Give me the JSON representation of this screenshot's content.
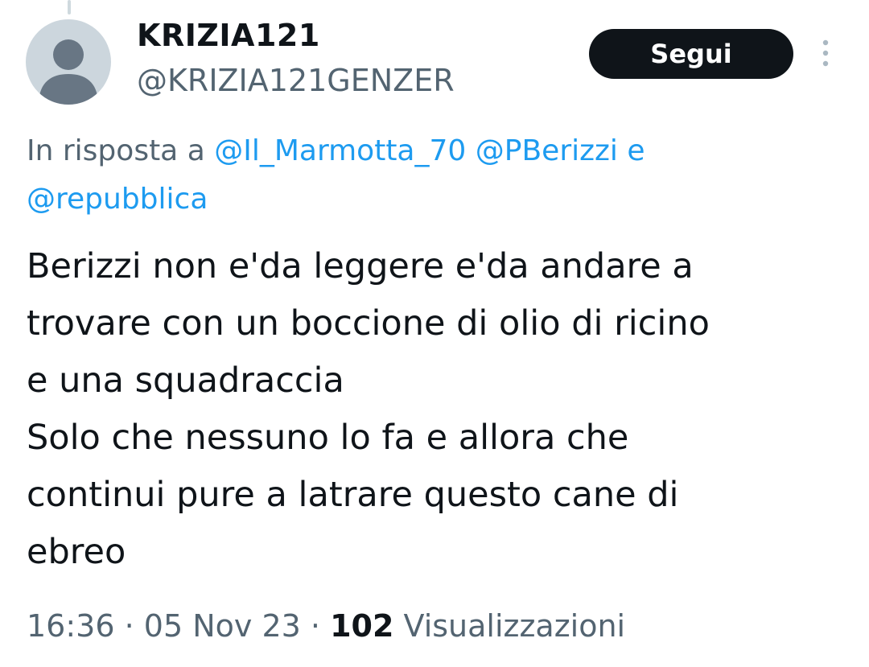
{
  "tweet": {
    "author": {
      "display_name": "KRIZIA121",
      "handle": "@KRIZIA121GENZER",
      "avatar_icon": "default-profile-icon"
    },
    "follow_label": "Segui",
    "more_icon": "more-vertical-icon",
    "reply_context": {
      "prefix": "In risposta a",
      "mention_1": "@Il_Marmotta_70",
      "mention_2": "@PBerizzi",
      "conjunction": "e",
      "mention_3": "@repubblica"
    },
    "text_lines": [
      "Berizzi non e'da leggere e'da andare a",
      "trovare con un boccione di olio di ricino",
      "e una squadraccia",
      "Solo che nessuno lo fa e allora che",
      "continui pure a latrare questo cane di",
      "ebreo"
    ],
    "time": "16:36",
    "separator": "·",
    "date": "05 Nov 23",
    "views_count": "102",
    "views_label": "Visualizzazioni"
  },
  "colors": {
    "text_primary": "#0f1419",
    "text_secondary": "#536471",
    "link": "#1d9bf0",
    "button_bg": "#0f1419",
    "avatar_bg": "#ccd6dd",
    "avatar_fg": "#687684"
  }
}
